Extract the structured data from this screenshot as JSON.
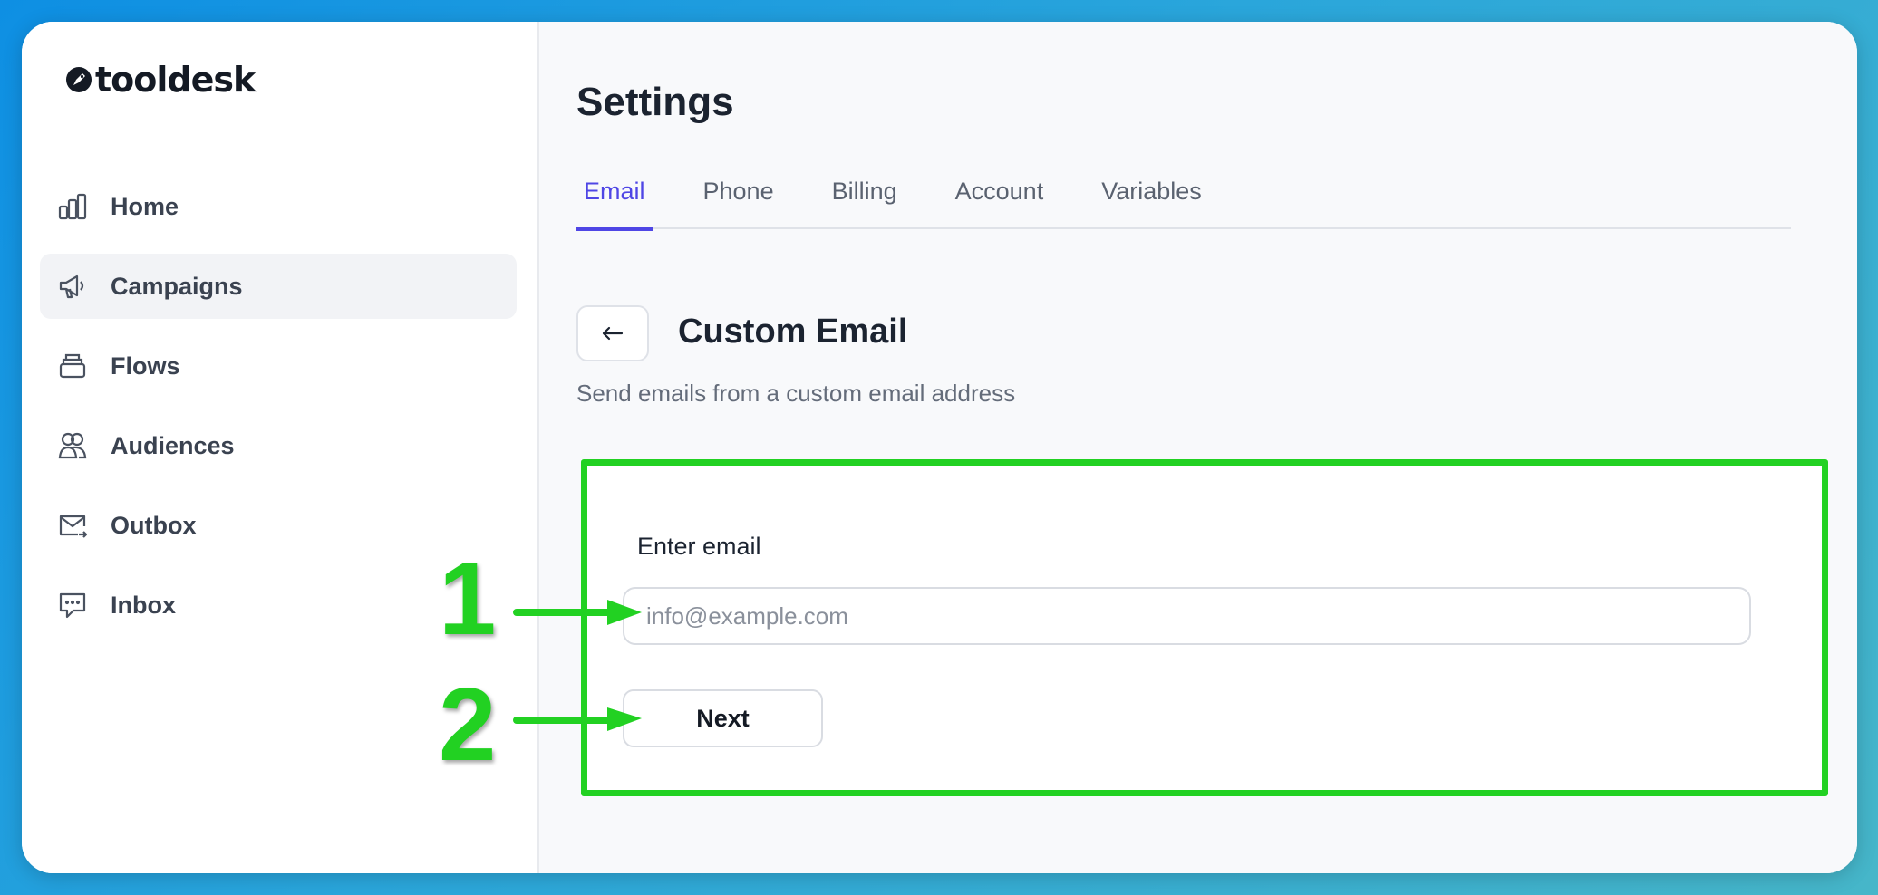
{
  "app": {
    "logo_text": "tooldesk",
    "logo_icon": "rocket-circle-icon"
  },
  "sidebar": {
    "items": [
      {
        "label": "Home",
        "icon": "bar-chart-icon",
        "active": false
      },
      {
        "label": "Campaigns",
        "icon": "megaphone-icon",
        "active": true
      },
      {
        "label": "Flows",
        "icon": "stack-icon",
        "active": false
      },
      {
        "label": "Audiences",
        "icon": "users-icon",
        "active": false
      },
      {
        "label": "Outbox",
        "icon": "mail-send-icon",
        "active": false
      },
      {
        "label": "Inbox",
        "icon": "chat-bubble-icon",
        "active": false
      }
    ]
  },
  "main": {
    "title": "Settings",
    "tabs": [
      {
        "label": "Email",
        "active": true
      },
      {
        "label": "Phone",
        "active": false
      },
      {
        "label": "Billing",
        "active": false
      },
      {
        "label": "Account",
        "active": false
      },
      {
        "label": "Variables",
        "active": false
      }
    ],
    "back_icon": "arrow-left-icon",
    "section_title": "Custom Email",
    "section_description": "Send emails from a custom email address",
    "form": {
      "email_label": "Enter email",
      "email_value": "",
      "email_placeholder": "info@example.com",
      "next_label": "Next"
    }
  },
  "annotations": {
    "step1": "1",
    "step2": "2",
    "color": "#22d122"
  },
  "colors": {
    "accent": "#4f46e5",
    "highlight": "#22d122"
  }
}
